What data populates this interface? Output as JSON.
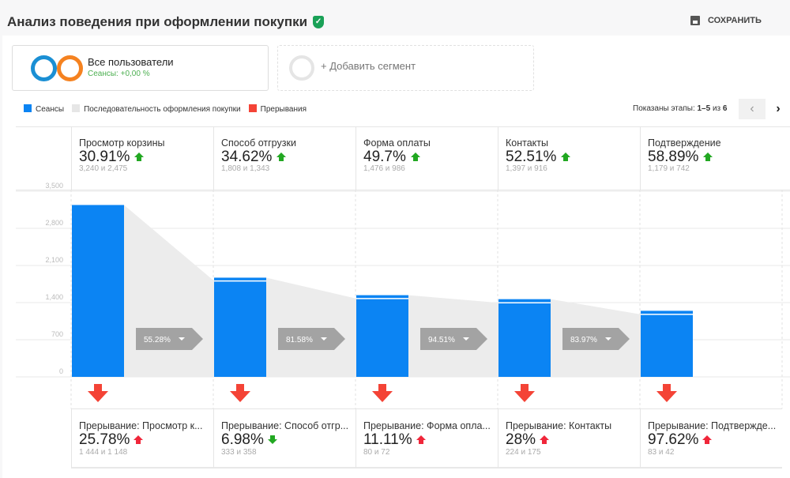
{
  "header": {
    "title": "Анализ поведения при оформлении покупки",
    "save_label": "СОХРАНИТЬ"
  },
  "segments": [
    {
      "name": "Все пользователи",
      "sub": "Сеансы: +0,00 %"
    },
    {
      "name": "+ Добавить сегмент"
    }
  ],
  "legend": [
    "Сеансы",
    "Последовательность оформления покупки",
    "Прерывания"
  ],
  "pager": {
    "label": "Показаны этапы: ",
    "range": "1–5",
    "of": " из ",
    "total": "6"
  },
  "colors": {
    "sessions": "#0b84f3",
    "flow": "#ececec",
    "drop": "#f44336",
    "up": "#22a822"
  },
  "steps": [
    {
      "name": "Просмотр корзины",
      "pct": "30.91%",
      "counts": "3,240 и 2,475",
      "trend": "up"
    },
    {
      "name": "Способ отгрузки",
      "pct": "34.62%",
      "counts": "1,808 и 1,343",
      "trend": "up"
    },
    {
      "name": "Форма оплаты",
      "pct": "49.7%",
      "counts": "1,476 и 986",
      "trend": "up"
    },
    {
      "name": "Контакты",
      "pct": "52.51%",
      "counts": "1,397 и 916",
      "trend": "up"
    },
    {
      "name": "Подтверждение",
      "pct": "58.89%",
      "counts": "1,179 и 742",
      "trend": "up"
    }
  ],
  "exits": [
    {
      "name": "Прерывание: Просмотр к...",
      "pct": "25.78%",
      "counts": "1 444 и 1 148",
      "trend": "up"
    },
    {
      "name": "Прерывание: Способ отгр...",
      "pct": "6.98%",
      "counts": "333 и 358",
      "trend": "down"
    },
    {
      "name": "Прерывание: Форма опла...",
      "pct": "11.11%",
      "counts": "80 и 72",
      "trend": "up"
    },
    {
      "name": "Прерывание: Контакты",
      "pct": "28%",
      "counts": "224 и 175",
      "trend": "up"
    },
    {
      "name": "Прерывание: Подтвержде...",
      "pct": "97.62%",
      "counts": "83 и 42",
      "trend": "up"
    }
  ],
  "chart_data": {
    "type": "bar",
    "categories": [
      "Просмотр корзины",
      "Способ отгрузки",
      "Форма оплаты",
      "Контакты",
      "Подтверждение"
    ],
    "series": [
      {
        "name": "Сеансы",
        "values": [
          3240,
          1870,
          1540,
          1465,
          1245
        ]
      },
      {
        "name": "Последовательность оформления покупки",
        "values": [
          1808,
          1476,
          1397,
          1179
        ]
      }
    ],
    "conversion_labels": [
      "55.28%",
      "81.58%",
      "94.51%",
      "83.97%"
    ],
    "yticks": [
      "0",
      "700",
      "1,400",
      "2,100",
      "2,800",
      "3,500"
    ],
    "ytick_values": [
      0,
      700,
      1400,
      2100,
      2800,
      3500
    ],
    "ylim": [
      0,
      3500
    ]
  }
}
